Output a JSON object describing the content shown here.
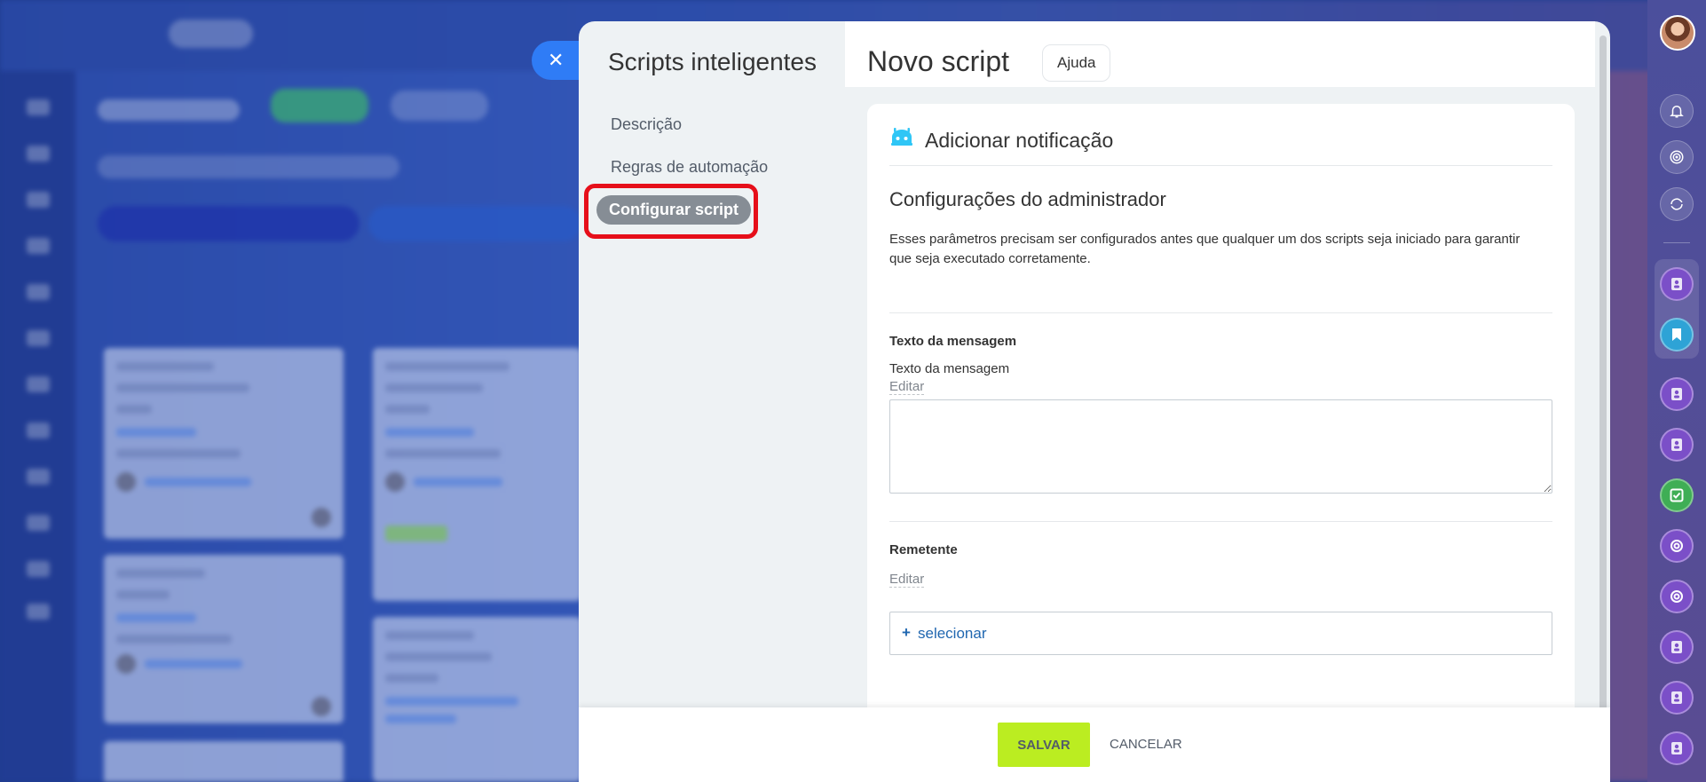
{
  "slider": {
    "close_icon": "close-icon",
    "sidebar": {
      "title": "Scripts inteligentes",
      "items": [
        {
          "label": "Descrição"
        },
        {
          "label": "Regras de automação"
        },
        {
          "label": "Configurar script",
          "active": true
        }
      ]
    },
    "header": {
      "title": "Novo script",
      "help_label": "Ajuda"
    },
    "section": {
      "icon": "robot-icon",
      "title": "Adicionar notificação",
      "admin_title": "Configurações do administrador",
      "admin_description": "Esses parâmetros precisam ser configurados antes que qualquer um dos scripts seja iniciado para garantir que seja executado corretamente."
    },
    "fields": {
      "message": {
        "label": "Texto da mensagem",
        "sublabel": "Texto da mensagem",
        "edit_label": "Editar",
        "value": ""
      },
      "sender": {
        "label": "Remetente",
        "edit_label": "Editar",
        "select_plus": "+",
        "select_label": "selecionar"
      }
    },
    "footer": {
      "save_label": "SALVAR",
      "cancel_label": "CANCELAR"
    }
  },
  "colors": {
    "accent_blue": "#2f7cf6",
    "link_blue": "#2067b0",
    "save_green": "#bbed21",
    "highlight_red": "#e60f1a",
    "active_pill": "#868d95"
  },
  "right_rail_icons": [
    "avatar",
    "bell-icon",
    "target-icon",
    "sync-icon",
    "contact-icon",
    "bookmark-icon",
    "contact-icon",
    "contact-icon",
    "task-icon",
    "crm-icon",
    "crm-icon",
    "contact-icon",
    "contact-icon",
    "contact-icon"
  ]
}
